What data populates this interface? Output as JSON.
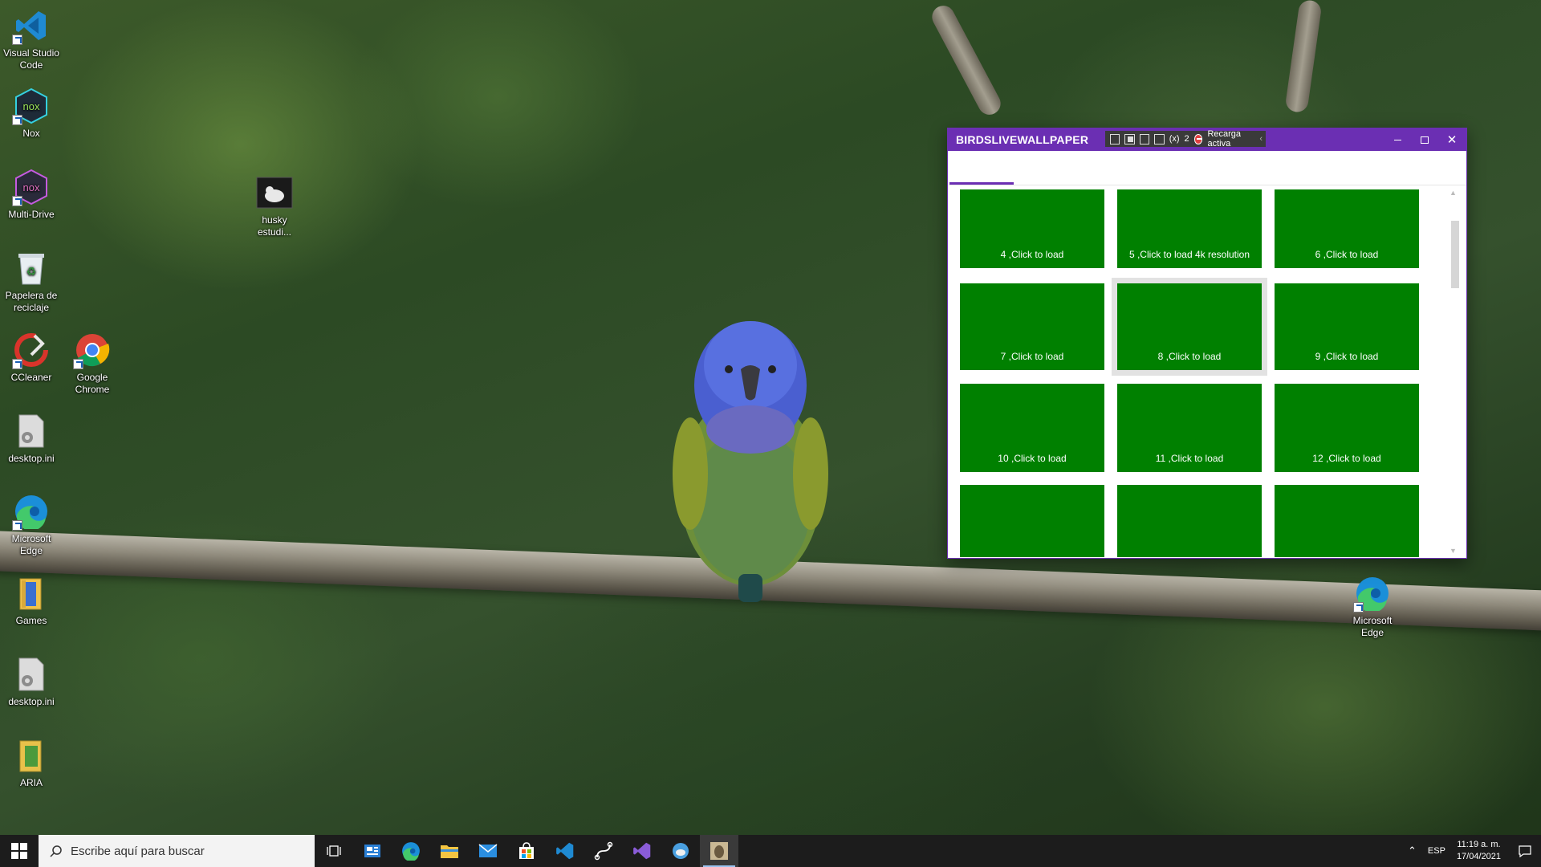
{
  "desktop": {
    "icons": [
      {
        "label": "Visual Studio Code"
      },
      {
        "label": "Nox"
      },
      {
        "label": "Multi-Drive"
      },
      {
        "label": "Papelera de reciclaje"
      },
      {
        "label": "CCleaner"
      },
      {
        "label": "Google Chrome"
      },
      {
        "label": "desktop.ini"
      },
      {
        "label": "Microsoft Edge"
      },
      {
        "label": "Games"
      },
      {
        "label": "desktop.ini"
      },
      {
        "label": "ARIA"
      },
      {
        "label": "husky estudi..."
      },
      {
        "label": "Microsoft Edge"
      }
    ]
  },
  "app": {
    "title": "BIRDSLIVEWALLPAPER",
    "toolbar": {
      "count": "2",
      "reload_label": "Recarga activa"
    },
    "accent_color": "#6b2fb3",
    "tile_color": "#008000",
    "tiles": [
      {
        "label": "4 ,Click to load"
      },
      {
        "label": "5 ,Click to load 4k resolution"
      },
      {
        "label": "6 ,Click to load"
      },
      {
        "label": "7 ,Click to load"
      },
      {
        "label": "8 ,Click to load"
      },
      {
        "label": "9 ,Click to load"
      },
      {
        "label": "10 ,Click to load"
      },
      {
        "label": "11 ,Click to load"
      },
      {
        "label": "12 ,Click to load"
      },
      {
        "label": ""
      },
      {
        "label": ""
      },
      {
        "label": ""
      }
    ]
  },
  "taskbar": {
    "search_placeholder": "Escribe aquí para buscar",
    "language": "ESP",
    "time": "11:19 a. m.",
    "date": "17/04/2021"
  }
}
